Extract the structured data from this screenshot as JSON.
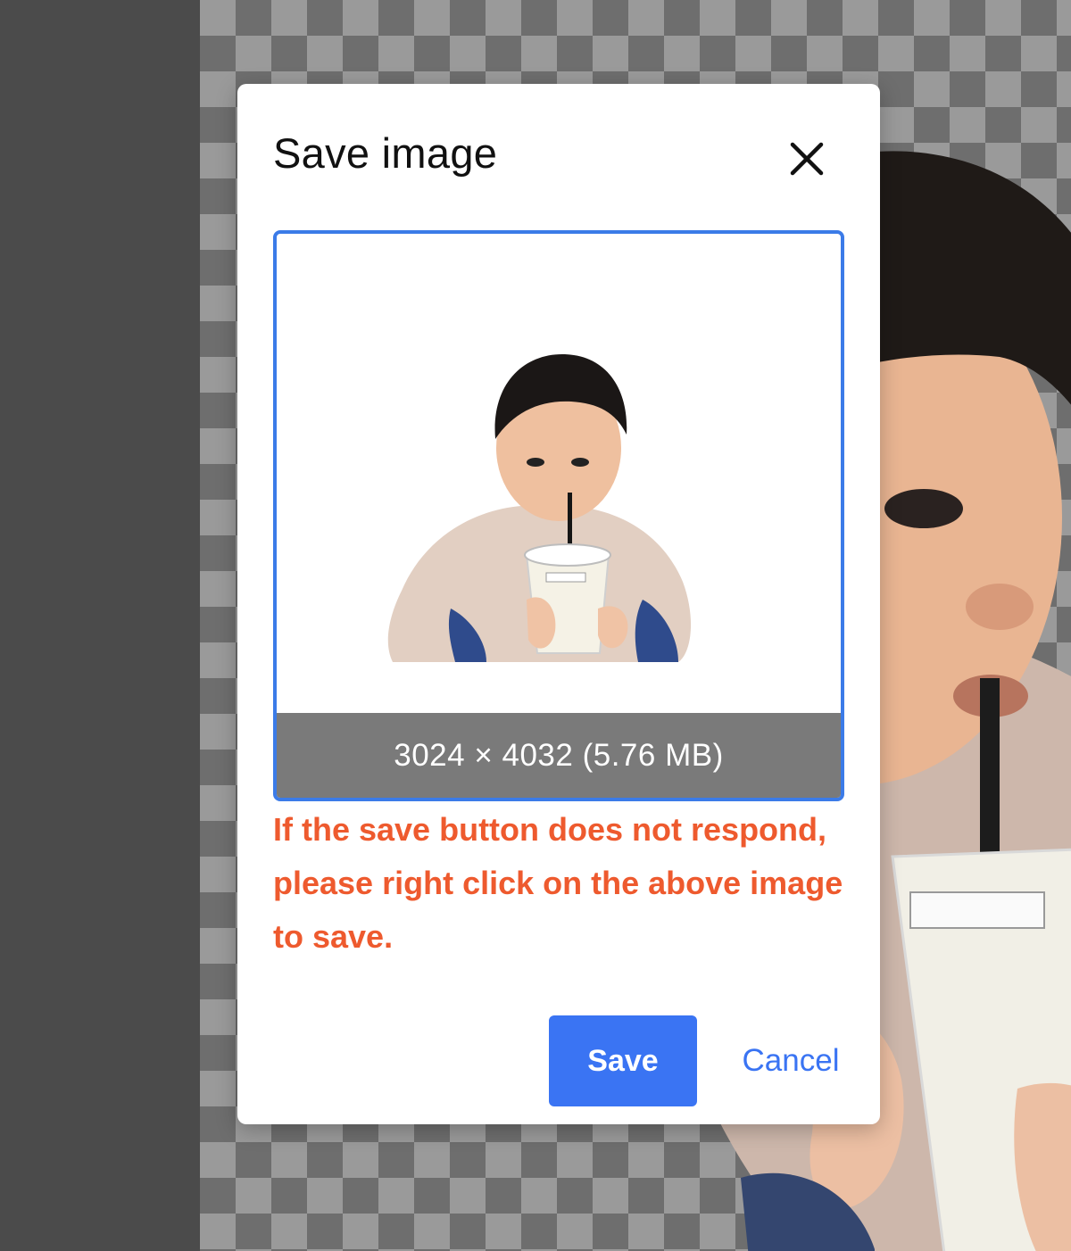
{
  "dialog": {
    "title": "Save image",
    "close_icon": "close-icon",
    "preview_caption": "3024 × 4032 (5.76 MB)",
    "warning": "If the save button does not respond, please right click on the above image to save.",
    "save_label": "Save",
    "cancel_label": "Cancel"
  },
  "colors": {
    "accent": "#3a74f3",
    "warning": "#ee5a2e",
    "caption_bg": "#7a7a7a"
  }
}
